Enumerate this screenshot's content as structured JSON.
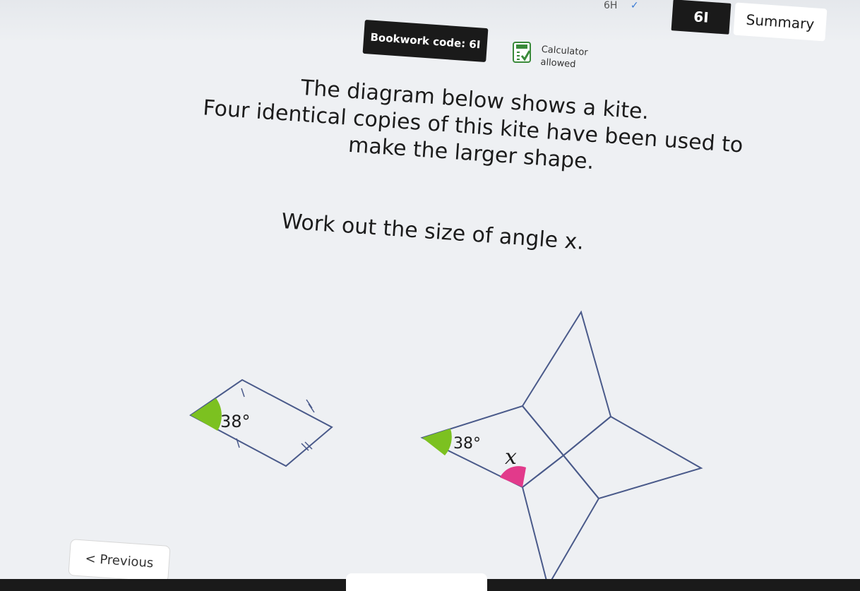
{
  "tabs": {
    "previous_tab": "6H",
    "current_tab": "6I",
    "summary_tab": "Summary"
  },
  "bookwork": {
    "code_label": "Bookwork code: 6I"
  },
  "calculator": {
    "line1": "Calculator",
    "line2": "allowed"
  },
  "question": {
    "line1": "The diagram below shows a kite.",
    "line2": "Four identical copies of this kite have been used to",
    "line3": "make the larger shape.",
    "prompt": "Work out the size of angle x."
  },
  "diagram": {
    "kite_angle_label": "38°",
    "shape_angle_label": "38°",
    "unknown_angle_label": "x"
  },
  "navigation": {
    "previous_label": "< Previous"
  },
  "colors": {
    "angle_green": "#7cc120",
    "angle_pink": "#e23a8b",
    "tab_dark": "#1a1a1a"
  }
}
